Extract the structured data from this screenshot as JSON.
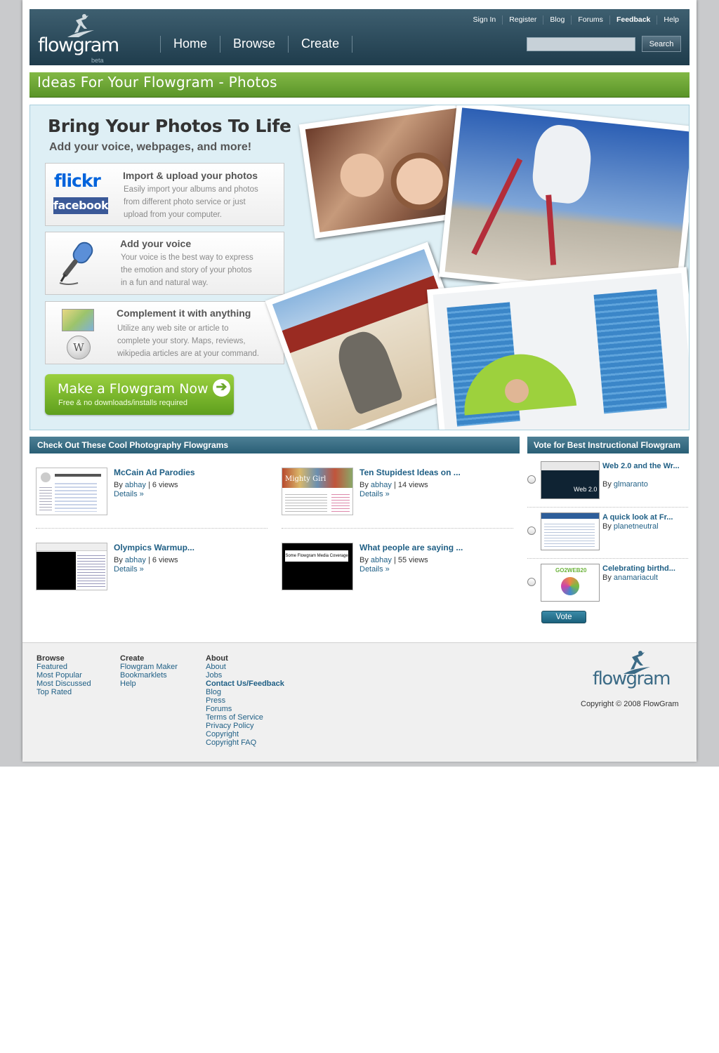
{
  "header": {
    "logo_text": "flowgram",
    "logo_beta": "beta",
    "main_nav": [
      "Home",
      "Browse",
      "Create"
    ],
    "top_nav": [
      "Sign In",
      "Register",
      "Blog",
      "Forums",
      "Feedback",
      "Help"
    ],
    "search_button": "Search",
    "search_value": ""
  },
  "page_title": "Ideas For Your Flowgram - Photos",
  "hero": {
    "title": "Bring Your Photos To Life",
    "subtitle": "Add your voice, webpages, and more!",
    "features": [
      {
        "title": "Import & upload your photos",
        "lines": [
          "Easily import your albums and photos",
          "from different photo service or just",
          "upload from your computer."
        ],
        "logos": [
          "flickr",
          "facebook"
        ]
      },
      {
        "title": "Add your voice",
        "lines": [
          "Your voice is the best way to express",
          "the emotion and story of your photos",
          "in a fun and natural way."
        ]
      },
      {
        "title": "Complement it with anything",
        "lines": [
          "Utilize any web site or article to",
          "complete your story. Maps, reviews,",
          "wikipedia articles are at your command."
        ]
      }
    ],
    "cta_title": "Make a Flowgram Now",
    "cta_subtitle": "Free & no downloads/installs required"
  },
  "cool_flowgrams": {
    "heading": "Check Out These Cool Photography Flowgrams",
    "items": [
      {
        "title": "McCain Ad Parodies",
        "by": "By",
        "author": "abhay",
        "views": "| 6 views",
        "details": "Details »"
      },
      {
        "title": "Ten Stupidest Ideas on ...",
        "by": "By",
        "author": "abhay",
        "views": "| 14 views",
        "details": "Details »"
      },
      {
        "title": "Olympics Warmup...",
        "by": "By",
        "author": "abhay",
        "views": "| 6 views",
        "details": "Details »"
      },
      {
        "title": "What people are saying ...",
        "by": "By",
        "author": "abhay",
        "views": "| 55 views",
        "details": "Details »",
        "thumb_caption": "Some Flowgram Media Coverage"
      }
    ]
  },
  "vote": {
    "heading": "Vote for Best Instructional Flowgram",
    "items": [
      {
        "title": "Web 2.0 and the Wr...",
        "by": "By",
        "author": "glmaranto",
        "thumb_caption": "Web 2.0"
      },
      {
        "title": "A quick look at Fr...",
        "by": "By",
        "author": "planetneutral"
      },
      {
        "title": "Celebrating birthd...",
        "by": "By",
        "author": "anamariacult",
        "thumb_caption": "GO2WEB20"
      }
    ],
    "button": "Vote"
  },
  "footer": {
    "browse": {
      "heading": "Browse",
      "links": [
        "Featured",
        "Most Popular",
        "Most Discussed",
        "Top Rated"
      ]
    },
    "create": {
      "heading": "Create",
      "links": [
        "Flowgram Maker",
        "Bookmarklets",
        "Help"
      ]
    },
    "about": {
      "heading": "About",
      "links": [
        "About",
        "Jobs",
        "Contact Us/Feedback",
        "Blog",
        "Press",
        "Forums",
        "Terms of Service",
        "Privacy Policy",
        "Copyright",
        "Copyright FAQ"
      ]
    },
    "logo_text": "flowgram",
    "copyright": "Copyright © 2008 FlowGram"
  },
  "colors": {
    "header": "#2c4a5a",
    "green_bar": "#6aa533",
    "hero_bg": "#deeff5",
    "link": "#1f5f85",
    "section_header": "#3a6f86"
  },
  "icons": [
    "surfer-logo-icon",
    "microphone-icon",
    "wikipedia-globe-icon",
    "map-icon",
    "arrow-right-icon"
  ]
}
